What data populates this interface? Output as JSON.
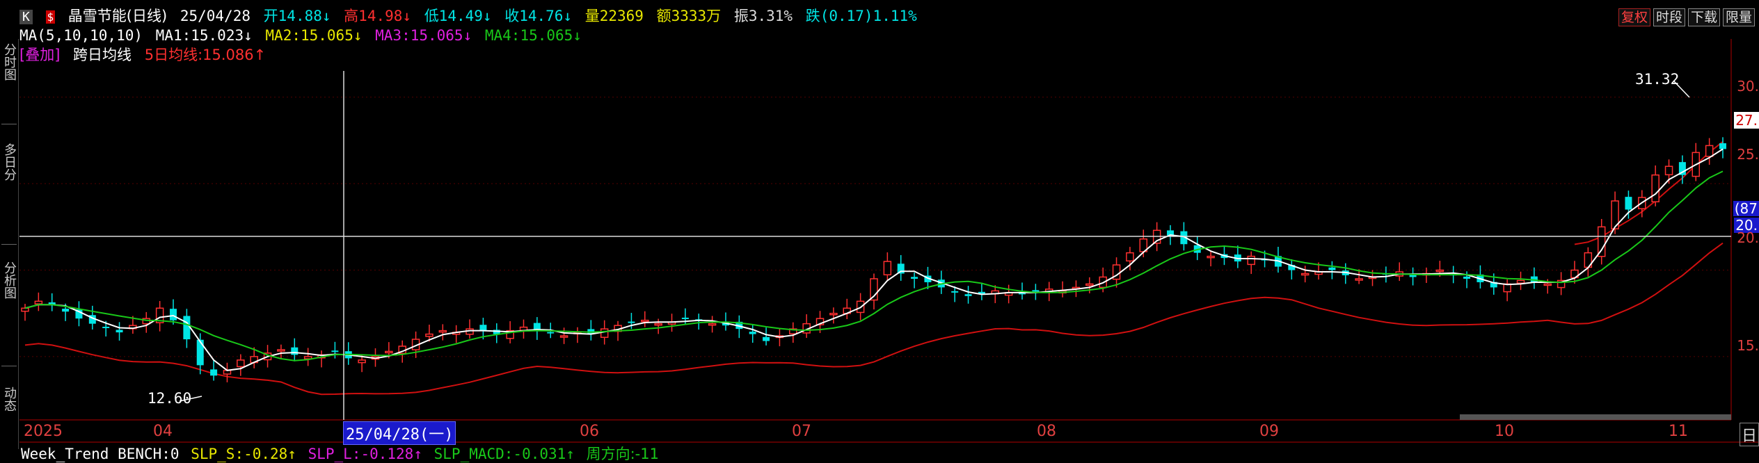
{
  "header": {
    "k_label": "K",
    "s_label": "$",
    "stock_name": "晶雪节能(日线)",
    "date": "25/04/28",
    "open": "开14.88↓",
    "high": "高14.98↓",
    "low": "低14.49↓",
    "close": "收14.76↓",
    "volume": "量22369",
    "amount": "额3333万",
    "amplitude": "振3.31%",
    "change": "跌(0.17)1.11%"
  },
  "ma_line": {
    "label": "MA(5,10,10,10)",
    "ma1": "MA1:15.023↓",
    "ma2": "MA2:15.065↓",
    "ma3": "MA3:15.065↓",
    "ma4": "MA4:15.065↓"
  },
  "overlay_line": {
    "tag": "[叠加]",
    "name": "跨日均线",
    "value": "5日均线:15.086↑"
  },
  "top_buttons": [
    "复权",
    "时段",
    "下载",
    "限量"
  ],
  "left_tabs": [
    "分时图",
    "多日分",
    "分析图",
    "动态"
  ],
  "price_labels": {
    "high_mark": "31.32",
    "low_mark": "12.60",
    "current_price": "27.",
    "cursor_box_top": "(87",
    "cursor_box_bottom": "20."
  },
  "y_axis_labels": [
    "30.",
    "25.",
    "20.",
    "15."
  ],
  "x_axis_labels": [
    "2025",
    "04",
    "06",
    "07",
    "08",
    "09",
    "10",
    "11",
    "日"
  ],
  "date_cursor": "25/04/28(一)",
  "bottom_bar": {
    "name": "Week_Trend BENCH:0",
    "slp_s": "SLP_S:-0.28↑",
    "slp_l": "SLP_L:-0.128↑",
    "slp_macd": "SLP_MACD:-0.031↑",
    "week_dir": "周方向:-11"
  },
  "colors": {
    "up": "#ff3030",
    "down": "#00e5e5",
    "ma_white": "#ffffff",
    "ma_green": "#19c819",
    "band_red": "#d01010",
    "yellow": "#e8e800",
    "magenta": "#e020e0"
  },
  "chart_data": {
    "type": "candlestick",
    "ylim": [
      11.5,
      32.0
    ],
    "annotations": [
      {
        "label": "31.32",
        "kind": "high"
      },
      {
        "label": "12.60",
        "kind": "low"
      }
    ],
    "close_series": [
      17.8,
      18.2,
      18.0,
      17.6,
      17.2,
      16.9,
      16.7,
      16.4,
      16.8,
      17.2,
      17.8,
      17.1,
      16.0,
      14.5,
      13.9,
      14.2,
      14.8,
      15.0,
      15.2,
      15.4,
      15.1,
      15.0,
      15.1,
      15.3,
      14.9,
      14.8,
      15.0,
      15.3,
      15.6,
      16.0,
      16.3,
      16.5,
      16.4,
      16.6,
      16.5,
      16.3,
      16.5,
      16.7,
      16.5,
      16.4,
      16.2,
      16.4,
      16.3,
      16.6,
      16.8,
      17.0,
      17.1,
      16.9,
      17.0,
      17.2,
      17.1,
      16.9,
      16.8,
      16.6,
      16.3,
      15.9,
      16.2,
      16.6,
      16.9,
      17.2,
      17.5,
      17.8,
      18.2,
      19.5,
      20.5,
      19.8,
      19.5,
      19.3,
      19.0,
      18.7,
      18.5,
      18.6,
      18.8,
      18.7,
      18.6,
      18.8,
      18.9,
      18.8,
      19.0,
      19.2,
      19.6,
      20.3,
      21.0,
      21.8,
      22.3,
      22.0,
      21.5,
      21.0,
      20.8,
      20.7,
      20.5,
      20.8,
      20.6,
      20.2,
      20.0,
      19.8,
      19.9,
      20.0,
      19.7,
      19.5,
      19.6,
      19.8,
      19.9,
      19.6,
      19.8,
      20.0,
      19.7,
      19.5,
      19.3,
      19.0,
      19.2,
      19.4,
      19.3,
      19.2,
      19.4,
      20.0,
      21.0,
      22.5,
      24.0,
      23.5,
      24.2,
      25.5,
      26.0,
      25.5,
      26.8,
      27.2,
      27.0
    ],
    "x_ticks": [
      "2025",
      "04",
      "06",
      "07",
      "08",
      "09",
      "10",
      "11"
    ]
  }
}
